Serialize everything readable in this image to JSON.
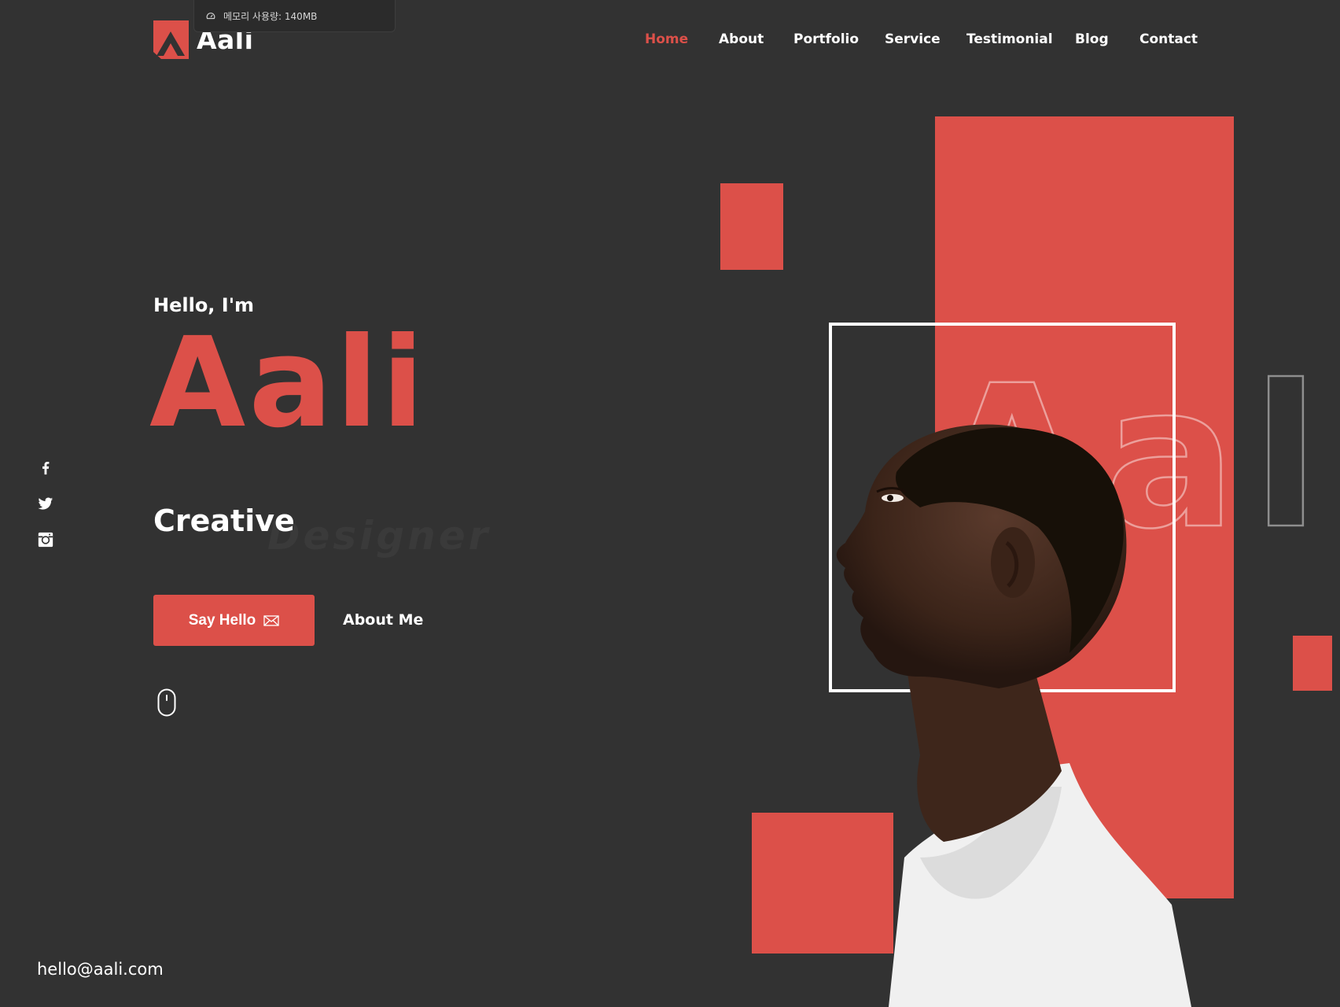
{
  "browser_overlay": {
    "memory_usage": "메모리 사용량: 140MB"
  },
  "brand": {
    "name": "Aali",
    "accent_color": "#dc5049",
    "background_color": "#323232"
  },
  "nav": {
    "items": [
      {
        "label": "Home",
        "active": true
      },
      {
        "label": "About",
        "active": false
      },
      {
        "label": "Portfolio",
        "active": false
      },
      {
        "label": "Service",
        "active": false
      },
      {
        "label": "Testimonial",
        "active": false
      },
      {
        "label": "Blog",
        "active": false
      },
      {
        "label": "Contact",
        "active": false
      }
    ]
  },
  "hero": {
    "greeting": "Hello, I'm",
    "name": "Aali",
    "role": "Creative",
    "role_secondary": "Designer",
    "primary_button": "Say Hello",
    "secondary_button": "About Me",
    "decorative_name": "Aali"
  },
  "social": {
    "icons": [
      "facebook-icon",
      "twitter-icon",
      "instagram-icon"
    ]
  },
  "footer": {
    "email": "hello@aali.com"
  }
}
